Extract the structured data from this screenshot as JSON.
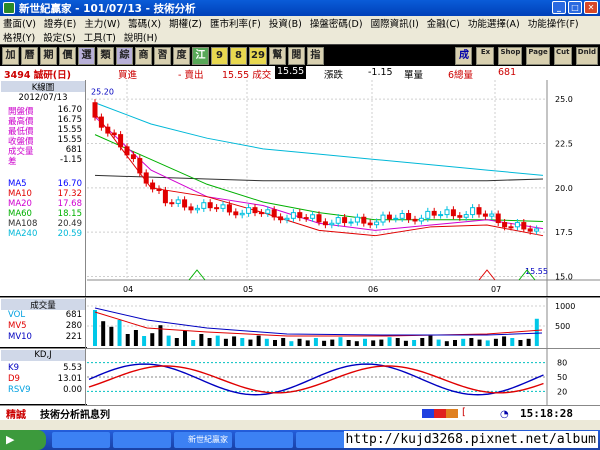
{
  "window": {
    "title": "新世紀贏家 - 101/07/13 - 技術分析"
  },
  "menu": {
    "row1": [
      "畫面(V)",
      "證券(E)",
      "主力(W)",
      "籌碼(X)",
      "期權(Z)",
      "匯市利率(F)",
      "投資(B)",
      "操盤密碼(D)",
      "國際資訊(I)",
      "金融(C)",
      "功能選擇(A)",
      "功能操作(F)"
    ],
    "row2": [
      "格視(Y)",
      "設定(S)",
      "工具(T)",
      "說明(H)"
    ]
  },
  "toolbar": {
    "buttons": [
      "加",
      "曆",
      "期",
      "價",
      "選",
      "類",
      "綜",
      "商",
      "習",
      "度",
      "江",
      "9",
      "8",
      "29",
      "幫",
      "閱",
      "指"
    ],
    "right": [
      "成",
      "Ex",
      "Shop",
      "Page",
      "Cut",
      "Dnld"
    ]
  },
  "info": {
    "stock": "3494 誠研(日)",
    "buy": "買進",
    "sell": "- 賣出",
    "last_label": "15.55 成交",
    "last_box": "15.55",
    "change_label": "漲跌",
    "change": "-1.15",
    "unit": "單量",
    "vol_label": "6總量",
    "vol": "681"
  },
  "kpanel": {
    "title": "K線圖",
    "date": "2012/07/13",
    "rows": [
      {
        "label": "開盤價",
        "value": "16.70",
        "color": "#cc00cc"
      },
      {
        "label": "最高價",
        "value": "16.75",
        "color": "#cc00cc"
      },
      {
        "label": "最低價",
        "value": "15.55",
        "color": "#cc00cc"
      },
      {
        "label": "收盤價",
        "value": "15.55",
        "color": "#cc00cc"
      },
      {
        "label": "成交量",
        "value": "681",
        "color": "#cc00cc"
      },
      {
        "label": "差",
        "value": "-1.15",
        "color": "#cc00cc"
      }
    ],
    "ma": [
      {
        "label": "MA5",
        "value": "16.70",
        "color": "#0000ff"
      },
      {
        "label": "MA10",
        "value": "17.32",
        "color": "#e00000"
      },
      {
        "label": "MA20",
        "value": "17.68",
        "color": "#d000d0"
      },
      {
        "label": "MA60",
        "value": "18.15",
        "color": "#00b000"
      },
      {
        "label": "MA108",
        "value": "20.49",
        "color": "#303030"
      },
      {
        "label": "MA240",
        "value": "20.59",
        "color": "#00b8d8"
      }
    ]
  },
  "chart_data": [
    {
      "type": "line",
      "title": "K線圖",
      "x": [
        "04",
        "05",
        "06",
        "07"
      ],
      "yticks": [
        "25.0",
        "22.5",
        "20.0",
        "17.5",
        "15.0"
      ],
      "ylim": [
        14.8,
        25.8
      ],
      "annotations": [
        "25.20",
        "15.55"
      ],
      "series": [
        {
          "name": "MA240",
          "values": [
            24.8,
            23.6,
            22.8,
            22.2,
            21.9,
            21.6,
            21.3,
            21.0,
            20.7
          ]
        },
        {
          "name": "MA108",
          "values": [
            20.7,
            20.6,
            20.5,
            20.4,
            20.4,
            20.4,
            20.4,
            20.4,
            20.5
          ]
        },
        {
          "name": "MA60",
          "values": [
            23.0,
            21.6,
            20.2,
            19.2,
            18.6,
            18.2,
            18.2,
            18.2,
            18.1
          ]
        },
        {
          "name": "MA20",
          "values": [
            24.0,
            21.0,
            19.5,
            19.0,
            18.0,
            17.6,
            17.9,
            18.2,
            17.7
          ]
        },
        {
          "name": "MA10",
          "values": [
            24.2,
            20.0,
            19.5,
            18.6,
            17.6,
            17.3,
            17.8,
            17.9,
            17.3
          ]
        }
      ]
    },
    {
      "type": "bar",
      "title": "成交量",
      "yticks": [
        "1000",
        "500"
      ],
      "series": [
        {
          "name": "VOL",
          "value": "681"
        },
        {
          "name": "MV5",
          "value": "280"
        },
        {
          "name": "MV10",
          "value": "221"
        }
      ],
      "values": [
        900,
        620,
        480,
        650,
        300,
        400,
        250,
        320,
        520,
        260,
        200,
        380,
        150,
        300,
        200,
        260,
        180,
        240,
        200,
        160,
        260,
        180,
        150,
        200,
        120,
        180,
        140,
        200,
        130,
        160,
        220,
        150,
        120,
        180,
        140,
        160,
        220,
        200,
        130,
        150,
        200,
        260,
        160,
        120,
        150,
        180,
        200,
        160,
        140,
        180,
        240,
        200,
        150,
        180,
        681
      ]
    },
    {
      "type": "line",
      "title": "KD,J",
      "yticks": [
        "80",
        "50",
        "20"
      ],
      "series": [
        {
          "name": "K9",
          "value": "5.53"
        },
        {
          "name": "D9",
          "value": "13.01"
        },
        {
          "name": "RSV9",
          "value": "0.00"
        }
      ]
    }
  ],
  "status": {
    "label": "精誠",
    "ticker": "技術分析訊息列",
    "bracket": "[",
    "time": "15:18:28"
  },
  "watermark": "http://kujd3268.pixnet.net/album",
  "taskbar": {
    "items": [
      "",
      "",
      "新世紀贏家",
      "",
      "",
      "",
      "",
      ""
    ]
  }
}
